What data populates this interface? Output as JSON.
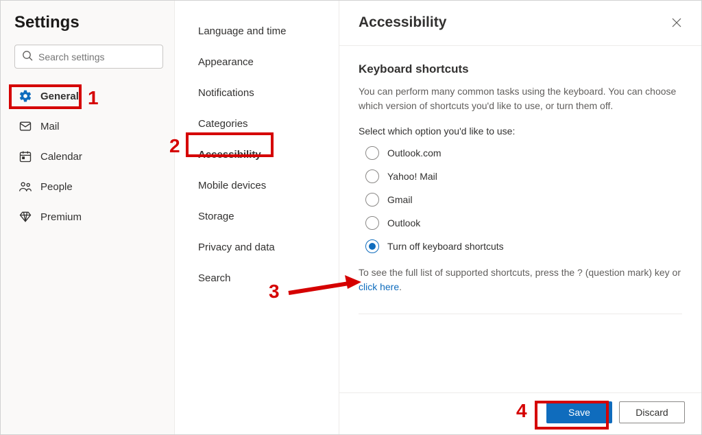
{
  "header": {
    "title": "Settings"
  },
  "search": {
    "placeholder": "Search settings"
  },
  "nav": {
    "items": [
      {
        "label": "General"
      },
      {
        "label": "Mail"
      },
      {
        "label": "Calendar"
      },
      {
        "label": "People"
      },
      {
        "label": "Premium"
      }
    ],
    "active_index": 0
  },
  "submenu": {
    "items": [
      {
        "label": "Language and time"
      },
      {
        "label": "Appearance"
      },
      {
        "label": "Notifications"
      },
      {
        "label": "Categories"
      },
      {
        "label": "Accessibility"
      },
      {
        "label": "Mobile devices"
      },
      {
        "label": "Storage"
      },
      {
        "label": "Privacy and data"
      },
      {
        "label": "Search"
      }
    ],
    "active_index": 4
  },
  "panel": {
    "title": "Accessibility",
    "section_title": "Keyboard shortcuts",
    "section_desc": "You can perform many common tasks using the keyboard. You can choose which version of shortcuts you'd like to use, or turn them off.",
    "radio_prompt": "Select which option you'd like to use:",
    "options": [
      {
        "label": "Outlook.com"
      },
      {
        "label": "Yahoo! Mail"
      },
      {
        "label": "Gmail"
      },
      {
        "label": "Outlook"
      },
      {
        "label": "Turn off keyboard shortcuts"
      }
    ],
    "selected_index": 4,
    "help_prefix": "To see the full list of supported shortcuts, press the ? (question mark) key or ",
    "help_link": "click here",
    "help_suffix": "."
  },
  "footer": {
    "save_label": "Save",
    "discard_label": "Discard"
  },
  "annotations": {
    "n1": "1",
    "n2": "2",
    "n3": "3",
    "n4": "4"
  }
}
